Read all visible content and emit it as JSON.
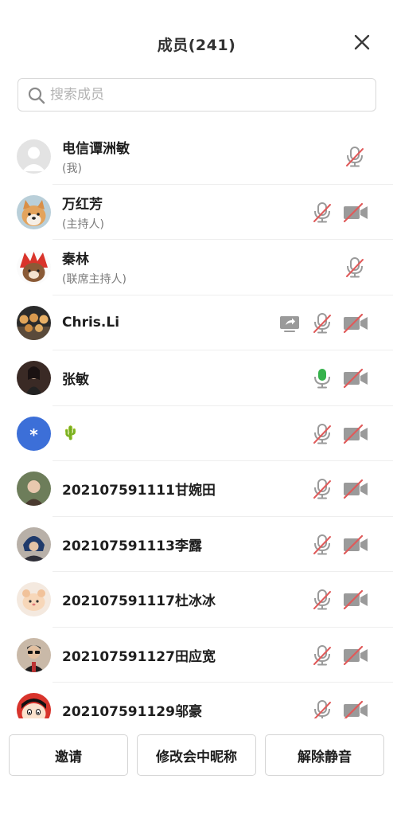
{
  "header": {
    "title": "成员(241)"
  },
  "search": {
    "placeholder": "搜索成员"
  },
  "members": [
    {
      "name": "电信谭洲敏",
      "role": "(我)",
      "mic": "muted",
      "camera": null,
      "share": false,
      "avatar": "default-person"
    },
    {
      "name": "万红芳",
      "role": "(主持人)",
      "mic": "muted",
      "camera": "off",
      "share": false,
      "avatar": "dog-photo"
    },
    {
      "name": "秦林",
      "role": "(联席主持人)",
      "mic": "muted",
      "camera": null,
      "share": false,
      "avatar": "cartoon-bear"
    },
    {
      "name": "Chris.Li",
      "role": "",
      "mic": "muted",
      "camera": "off",
      "share": true,
      "avatar": "food-photo"
    },
    {
      "name": "张敏",
      "role": "",
      "mic": "active",
      "camera": "off",
      "share": false,
      "avatar": "person-photo-dark"
    },
    {
      "name": "🌵",
      "role": "",
      "mic": "muted",
      "camera": "off",
      "share": false,
      "avatar": "blue-asterisk",
      "avatar_text": "*"
    },
    {
      "name": "202107591111甘婉田",
      "role": "",
      "mic": "muted",
      "camera": "off",
      "share": false,
      "avatar": "person-photo"
    },
    {
      "name": "202107591113李露",
      "role": "",
      "mic": "muted",
      "camera": "off",
      "share": false,
      "avatar": "person-photo-blue"
    },
    {
      "name": "202107591117杜冰冰",
      "role": "",
      "mic": "muted",
      "camera": "off",
      "share": false,
      "avatar": "cute-animal"
    },
    {
      "name": "202107591127田应宽",
      "role": "",
      "mic": "muted",
      "camera": "off",
      "share": false,
      "avatar": "person-photo-sunglasses"
    },
    {
      "name": "202107591129邬豪",
      "role": "",
      "mic": "muted",
      "camera": "off",
      "share": false,
      "avatar": "cartoon-boy"
    }
  ],
  "footer": {
    "invite_label": "邀请",
    "rename_label": "修改会中昵称",
    "unmute_label": "解除静音"
  },
  "colors": {
    "muted_red": "#e05a5a",
    "icon_gray": "#9a9a9a",
    "mic_active_green": "#35b24b",
    "avatar_blue": "#3c6fd8"
  }
}
